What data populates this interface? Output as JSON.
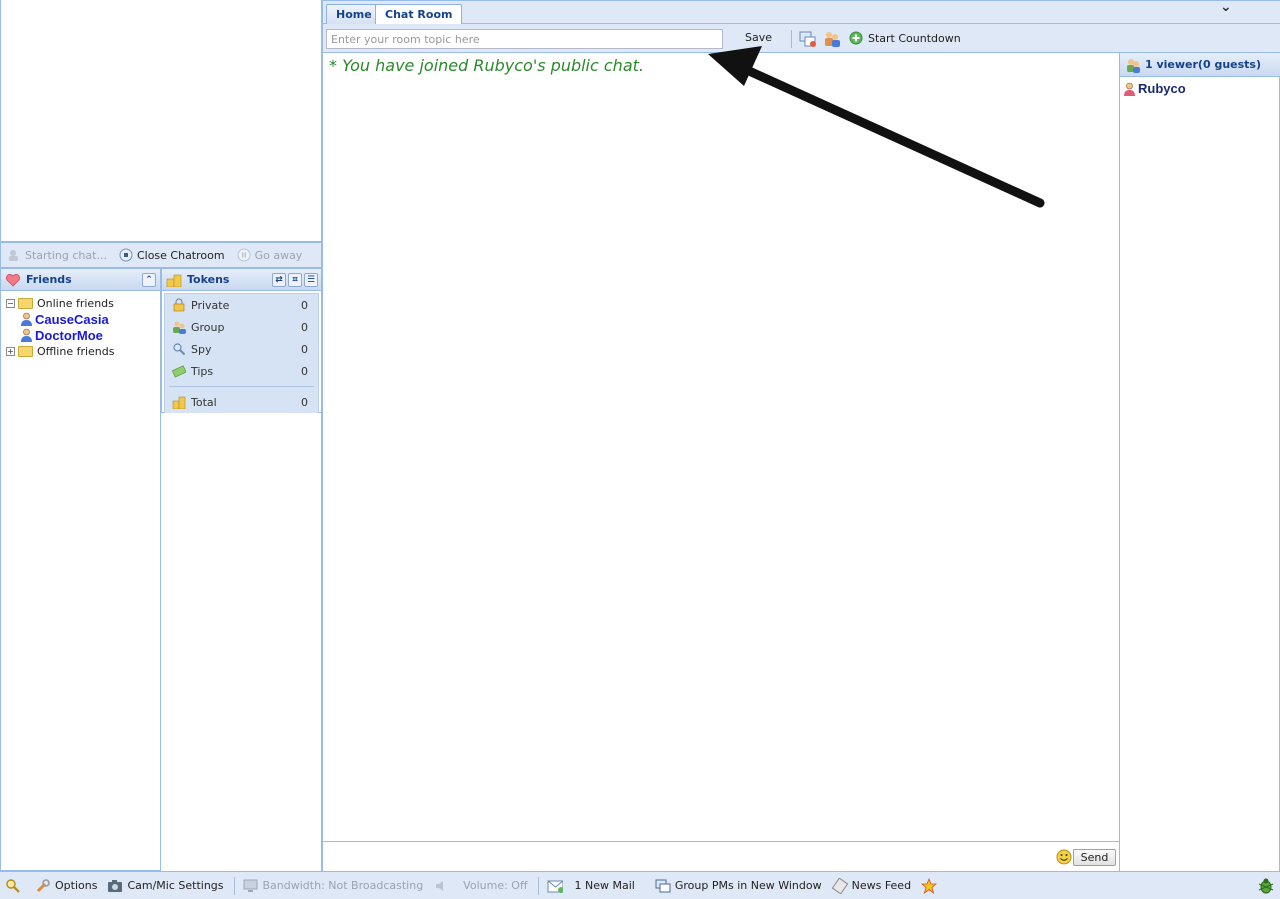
{
  "tabs": [
    {
      "label": "Home",
      "active": false
    },
    {
      "label": "Chat Room",
      "active": true
    }
  ],
  "topicbar": {
    "topic_placeholder": "Enter your room topic here",
    "save_label": "Save",
    "countdown_label": "Start Countdown"
  },
  "controls": {
    "starting_chat": "Starting chat...",
    "close_chatroom": "Close Chatroom",
    "go_away": "Go away"
  },
  "friends": {
    "title": "Friends",
    "online_label": "Online friends",
    "online": [
      "CauseCasia",
      "DoctorMoe"
    ],
    "offline_label": "Offline friends"
  },
  "tokens": {
    "title": "Tokens",
    "rows": [
      {
        "label": "Private",
        "value": "0"
      },
      {
        "label": "Group",
        "value": "0"
      },
      {
        "label": "Spy",
        "value": "0"
      },
      {
        "label": "Tips",
        "value": "0"
      }
    ],
    "total": {
      "label": "Total",
      "value": "0"
    }
  },
  "chat": {
    "messages": [
      "* You have joined Rubyco's public chat."
    ],
    "send_label": "Send"
  },
  "viewers": {
    "title": "1 viewer(0 guests)",
    "users": [
      "Rubyco"
    ]
  },
  "status": {
    "options": "Options",
    "cam_mic": "Cam/Mic Settings",
    "bandwidth": "Bandwidth: Not Broadcasting",
    "volume": "Volume: Off",
    "mail": "1 New Mail",
    "group_pms": "Group PMs in New Window",
    "news_feed": "News Feed"
  },
  "colors": {
    "panel_bg": "#dfe8f6",
    "border": "#99bbe8",
    "header_text": "#15428b",
    "chat_text": "#2a8a2a",
    "friend_name": "#1a1adb"
  }
}
